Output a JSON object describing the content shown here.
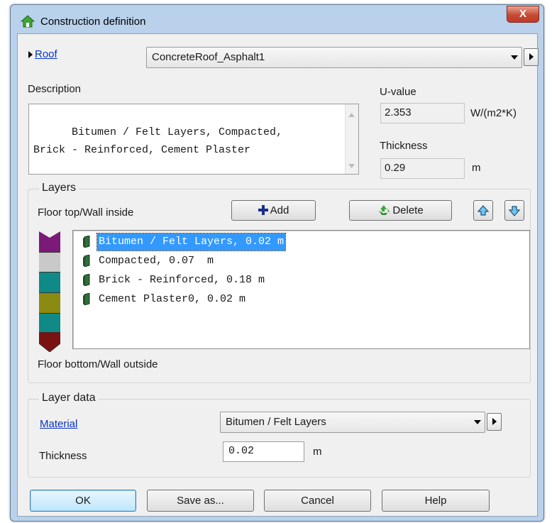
{
  "window": {
    "title": "Construction definition",
    "close_glyph": "X"
  },
  "construction": {
    "type_link": "Roof",
    "selected": "ConcreteRoof_Asphalt1"
  },
  "description": {
    "label": "Description",
    "text": "Bitumen / Felt Layers, Compacted,\nBrick - Reinforced, Cement Plaster"
  },
  "u_value": {
    "label": "U-value",
    "value": "2.353",
    "unit": "W/(m2*K)"
  },
  "thickness_total": {
    "label": "Thickness",
    "value": "0.29",
    "unit": "m"
  },
  "layers": {
    "group_label": "Layers",
    "top_label": "Floor top/Wall inside",
    "bottom_label": "Floor bottom/Wall outside",
    "add_label": "Add",
    "delete_label": "Delete",
    "items": [
      {
        "label": "Bitumen / Felt Layers, 0.02 m",
        "selected": true
      },
      {
        "label": "Compacted, 0.07  m",
        "selected": false
      },
      {
        "label": "Brick - Reinforced, 0.18 m",
        "selected": false
      },
      {
        "label": "Cement Plaster0, 0.02 m",
        "selected": false
      }
    ],
    "swatch_colors": [
      "#7b1a78",
      "#c9c9c9",
      "#0f8a86",
      "#8a8b10",
      "#0f8a86",
      "#7a1212"
    ]
  },
  "layer_data": {
    "group_label": "Layer data",
    "material_link": "Material",
    "material_value": "Bitumen / Felt Layers",
    "thickness_label": "Thickness",
    "thickness_value": "0.02",
    "thickness_unit": "m"
  },
  "buttons": {
    "ok": "OK",
    "save_as": "Save as...",
    "cancel": "Cancel",
    "help": "Help"
  },
  "icons": {
    "title": "house-icon",
    "add": "plus-icon",
    "delete": "recycle-icon",
    "up": "arrow-up-icon",
    "down": "arrow-down-icon",
    "layer": "layer-icon"
  },
  "colors": {
    "selection": "#3399ff",
    "link": "#0a33c2",
    "close": "#c74b33"
  }
}
